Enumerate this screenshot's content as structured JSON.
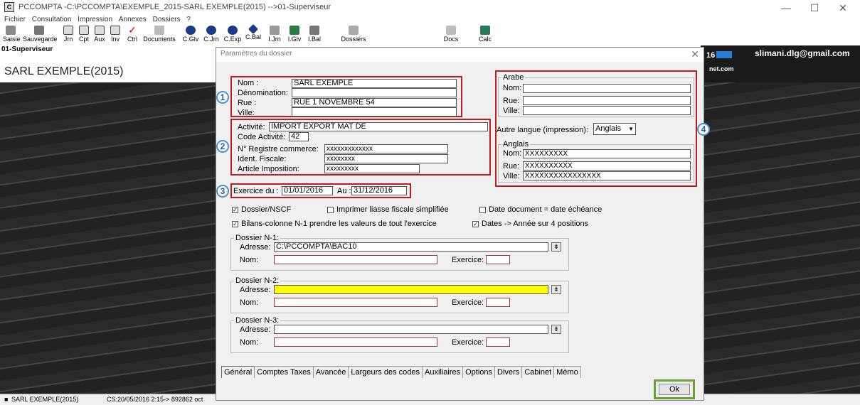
{
  "window": {
    "title": "PCCOMPTA -C:\\PCCOMPTA\\EXEMPLE_2015-SARL EXEMPLE(2015) -->01-Superviseur",
    "minimize": "—",
    "maximize": "☐",
    "close": "✕"
  },
  "menu": [
    "Fichier",
    "Consultation",
    "Impression",
    "Annexes",
    "Dossiers",
    "?"
  ],
  "toolbar": [
    "Saisie",
    "Sauvegarde",
    "Jrn",
    "Cpt",
    "Aux",
    "Inv",
    "Ctrl",
    "Documents",
    "C.Glv",
    "C.Jrn",
    "C.Exp",
    "C.Bal",
    "I.Jrn",
    "I.Glv",
    "I.Bal",
    "Dossiers",
    "Docs",
    "Calc"
  ],
  "user": "01-Superviseur",
  "company": "SARL EXEMPLE(2015)",
  "email": "slimani.dlg@gmail.com",
  "header_fragments": {
    "year": "16",
    "domain": "net.com"
  },
  "statusbar": {
    "company": "SARL EXEMPLE(2015)",
    "info": "CS:20/05/2016 2:15-> 892862 oct"
  },
  "dialog": {
    "title": "Paramètres du dossier",
    "labels": {
      "nom": "Nom :",
      "denomination": "Dénomination:",
      "rue": "Rue :",
      "ville": "Ville:",
      "activite": "Activité:",
      "code_activite": "Code Activité:",
      "registre": "N° Registre commerce:",
      "ident": "Ident. Fiscale:",
      "article": "Article Imposition:",
      "exercice_du": "Exercice du :",
      "au": "Au :",
      "autre_langue": "Autre langue (impression):",
      "arabe": "Arabe",
      "anglais": "Anglais",
      "nom2": "Nom:",
      "rue2": "Rue:",
      "ville2": "Ville:",
      "nom3": "Nom:",
      "rue3": "Rue:",
      "ville3": "Ville:"
    },
    "values": {
      "nom": "SARL EXEMPLE",
      "denomination": "",
      "rue": "RUE 1 NOVEMBRE 54",
      "ville": "",
      "activite": "IMPORT EXPORT MAT DE",
      "code_activite": "42",
      "registre": "xxxxxxxxxxxxx",
      "ident": "xxxxxxxx",
      "article": "xxxxxxxxx",
      "exercice_du": "01/01/2016",
      "au": "31/12/2016",
      "autre_langue": "Anglais",
      "anglais_nom": "XXXXXXXXX",
      "anglais_rue": "XXXXXXXXXX",
      "anglais_ville": "XXXXXXXXXXXXXXXX"
    },
    "badges": [
      "1",
      "2",
      "3",
      "4"
    ],
    "checkboxes": [
      {
        "label": "Dossier/NSCF",
        "checked": "✓"
      },
      {
        "label": "Imprimer liasse fiscale simplifiée",
        "checked": ""
      },
      {
        "label": "Date document = date échéance",
        "checked": ""
      },
      {
        "label": "Bilans-colonne N-1 prendre les valeurs de tout l'exercice",
        "checked": "✓"
      },
      {
        "label": "Dates -> Année sur 4 positions",
        "checked": "✓"
      }
    ],
    "dossiers": [
      {
        "title": "Dossier N-1:",
        "adresse_label": "Adresse:",
        "adresse": "C:\\PCCOMPTA\\BAC10",
        "nom_label": "Nom:",
        "exercice_label": "Exercice:"
      },
      {
        "title": "Dossier N-2:",
        "adresse_label": "Adresse:",
        "adresse": "",
        "nom_label": "Nom:",
        "exercice_label": "Exercice:"
      },
      {
        "title": "Dossier N-3:",
        "adresse_label": "Adresse:",
        "adresse": "",
        "nom_label": "Nom:",
        "exercice_label": "Exercice:"
      }
    ],
    "tabs": [
      "Général",
      "Comptes Taxes",
      "Avancée",
      "Largeurs des codes",
      "Auxiliaires",
      "Options",
      "Divers",
      "Cabinet",
      "Mémo"
    ],
    "ok": "Ok"
  },
  "colors": {
    "highlight": "#c41a1a",
    "badge": "#4a90d9",
    "ok_frame": "#6a9f3a",
    "n2_field": "#ffff00"
  }
}
